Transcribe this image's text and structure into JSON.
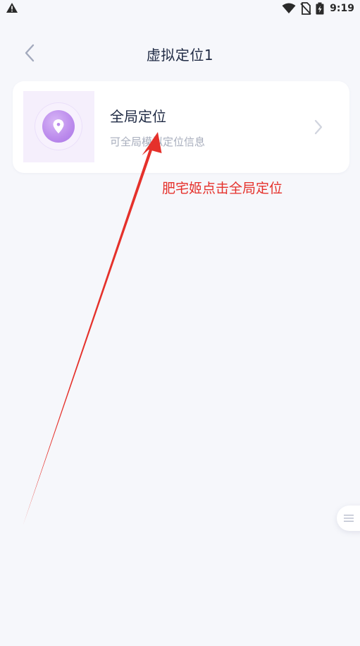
{
  "status_bar": {
    "time": "9:19",
    "icons": [
      "warning-icon",
      "wifi-icon",
      "no-sim-icon",
      "battery-charging-icon"
    ]
  },
  "header": {
    "title": "虚拟定位1",
    "back_icon": "chevron-left-icon"
  },
  "card": {
    "title": "全局定位",
    "subtitle": "可全局模拟定位信息",
    "thumb_icon": "location-pin-icon",
    "chevron_icon": "chevron-right-icon"
  },
  "annotation": {
    "text": "肥宅姬点击全局定位",
    "color": "#e5312b"
  },
  "float_button": {
    "icon": "menu-lines-icon"
  },
  "colors": {
    "background": "#f6f7fb",
    "accent_purple": "#bb8aec",
    "title_text": "#1f2a44",
    "subtitle_text": "#a8aebd"
  }
}
